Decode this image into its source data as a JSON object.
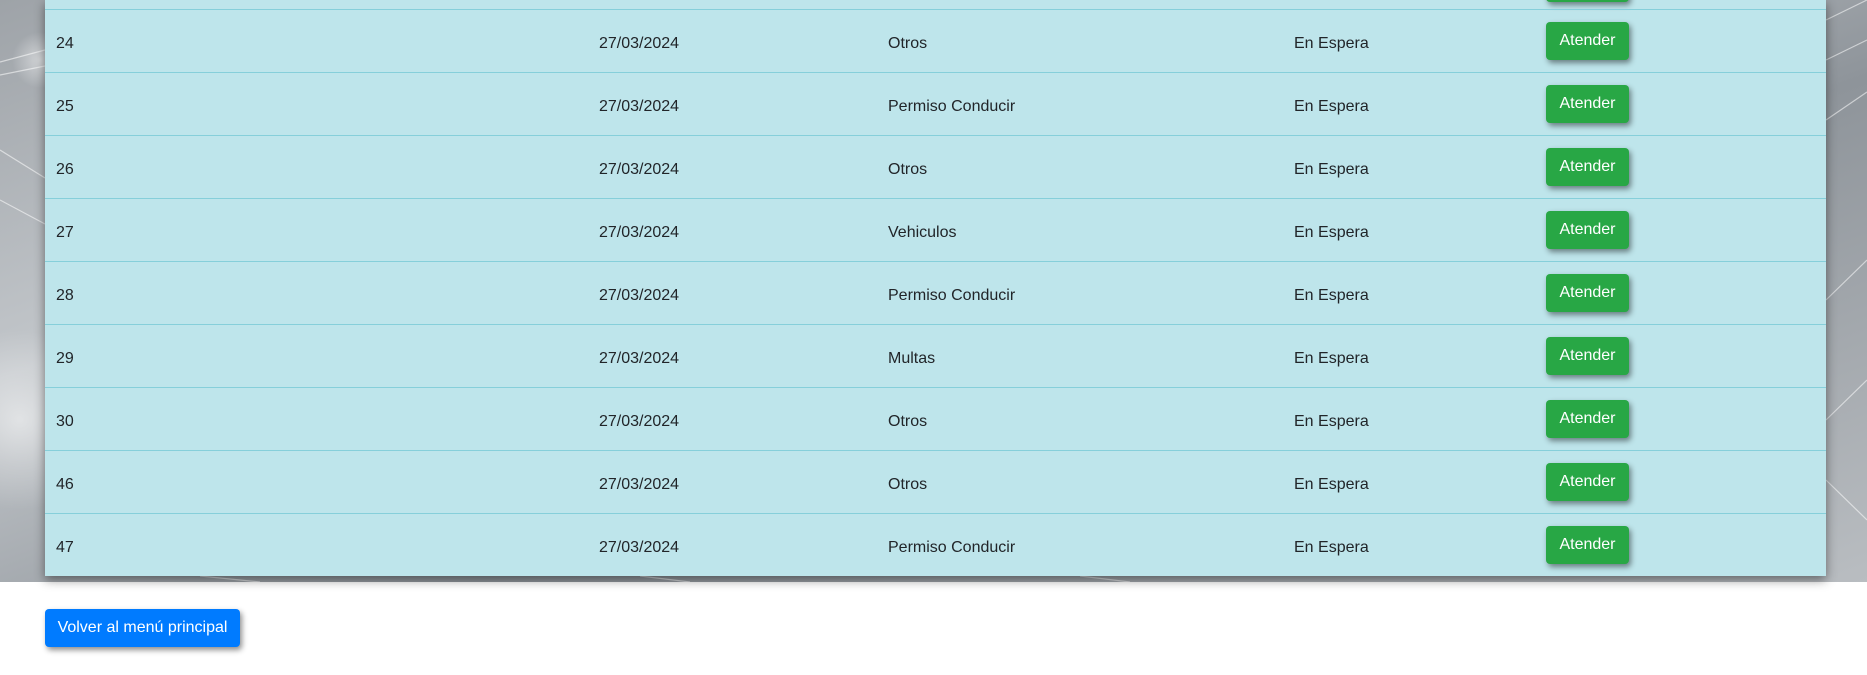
{
  "table": {
    "rows": [
      {
        "id": "24",
        "date": "27/03/2024",
        "type": "Otros",
        "status": "En Espera",
        "action": "Atender"
      },
      {
        "id": "25",
        "date": "27/03/2024",
        "type": "Permiso Conducir",
        "status": "En Espera",
        "action": "Atender"
      },
      {
        "id": "26",
        "date": "27/03/2024",
        "type": "Otros",
        "status": "En Espera",
        "action": "Atender"
      },
      {
        "id": "27",
        "date": "27/03/2024",
        "type": "Vehiculos",
        "status": "En Espera",
        "action": "Atender"
      },
      {
        "id": "28",
        "date": "27/03/2024",
        "type": "Permiso Conducir",
        "status": "En Espera",
        "action": "Atender"
      },
      {
        "id": "29",
        "date": "27/03/2024",
        "type": "Multas",
        "status": "En Espera",
        "action": "Atender"
      },
      {
        "id": "30",
        "date": "27/03/2024",
        "type": "Otros",
        "status": "En Espera",
        "action": "Atender"
      },
      {
        "id": "46",
        "date": "27/03/2024",
        "type": "Otros",
        "status": "En Espera",
        "action": "Atender"
      },
      {
        "id": "47",
        "date": "27/03/2024",
        "type": "Permiso Conducir",
        "status": "En Espera",
        "action": "Atender"
      }
    ]
  },
  "footer": {
    "back_label": "Volver al menú principal"
  },
  "colors": {
    "row_bg": "#bee5eb",
    "row_border": "#86cfda",
    "atender_button": "#28a745",
    "back_button": "#007bff"
  }
}
